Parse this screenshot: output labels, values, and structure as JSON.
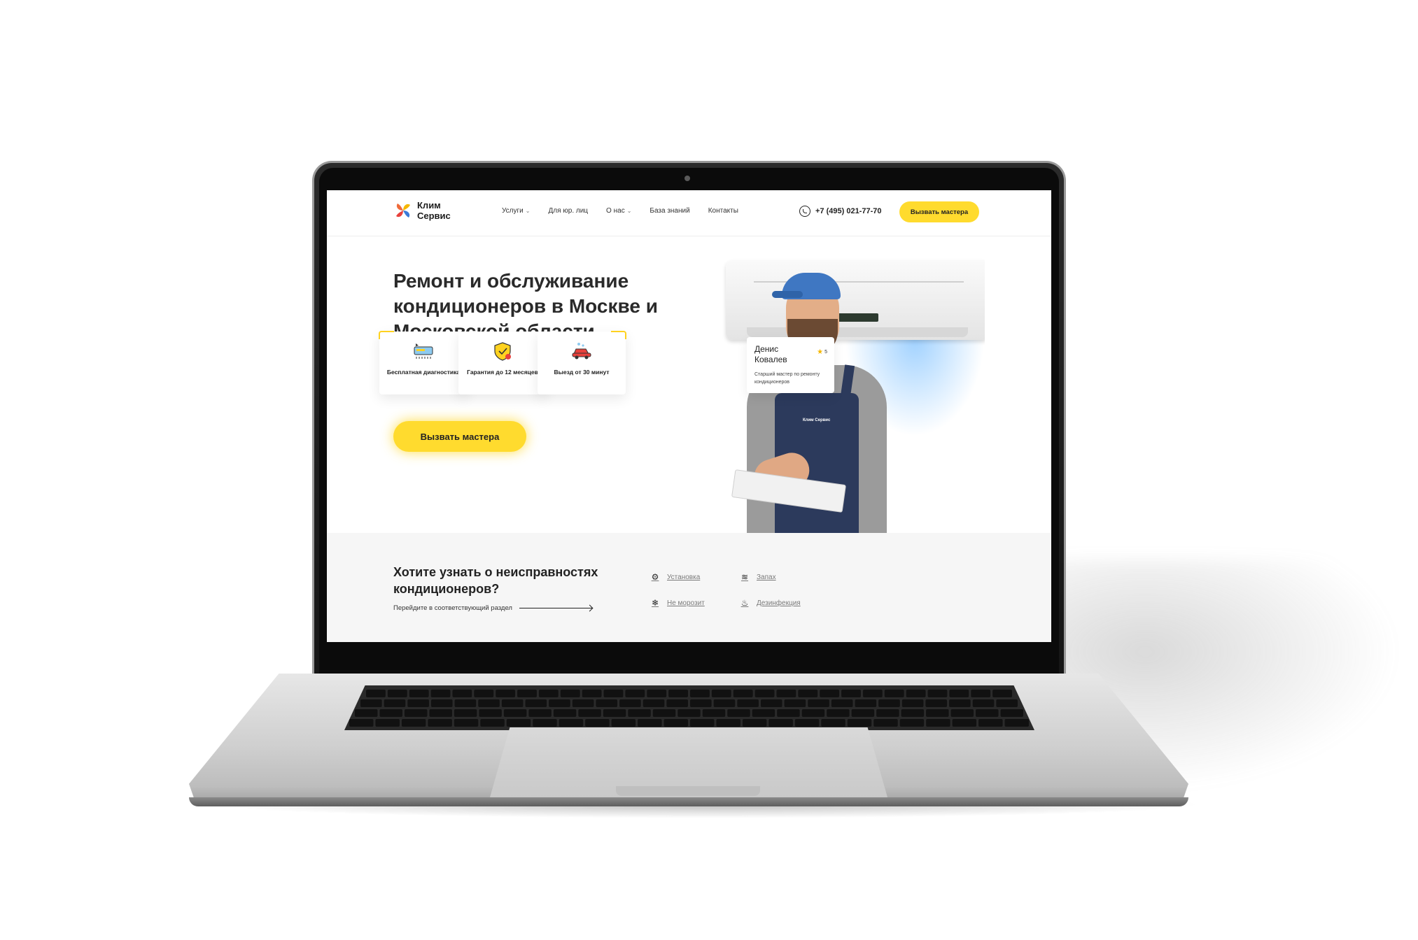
{
  "header": {
    "logo_line1": "Клим",
    "logo_line2": "Сервис",
    "nav": [
      {
        "label": "Услуги",
        "dropdown": true
      },
      {
        "label": "Для юр. лиц",
        "dropdown": false
      },
      {
        "label": "О нас",
        "dropdown": true
      },
      {
        "label": "База знаний",
        "dropdown": false
      },
      {
        "label": "Контакты",
        "dropdown": false
      }
    ],
    "phone": "+7 (495) 021-77-70",
    "cta_label": "Вызвать мастера"
  },
  "hero": {
    "title": "Ремонт и обслуживание кондиционеров в Москве и Московской области",
    "features": [
      {
        "label": "Бесплатная диагностика",
        "icon": "diagnostics-icon"
      },
      {
        "label": "Гарантия до 12 месяцев",
        "icon": "guarantee-shield-icon"
      },
      {
        "label": "Выезд от 30 минут",
        "icon": "car-icon"
      }
    ],
    "cta_label": "Вызвать мастера"
  },
  "master": {
    "name": "Денис Ковалев",
    "rating": "5",
    "role": "Старший мастер по ремонту кондиционеров",
    "overalls_logo": "Клим Сервис"
  },
  "faults": {
    "title": "Хотите узнать о неисправностях кондиционеров?",
    "subtitle": "Перейдите в соответствующий раздел",
    "links": [
      {
        "label": "Установка",
        "icon": "gear-icon"
      },
      {
        "label": "Запах",
        "icon": "smell-icon"
      },
      {
        "label": "Не морозит",
        "icon": "snowflake-icon"
      },
      {
        "label": "Дезинфекция",
        "icon": "spray-icon"
      }
    ]
  },
  "colors": {
    "accent": "#ffdb2e",
    "text": "#222222",
    "section_bg": "#f6f6f6"
  }
}
